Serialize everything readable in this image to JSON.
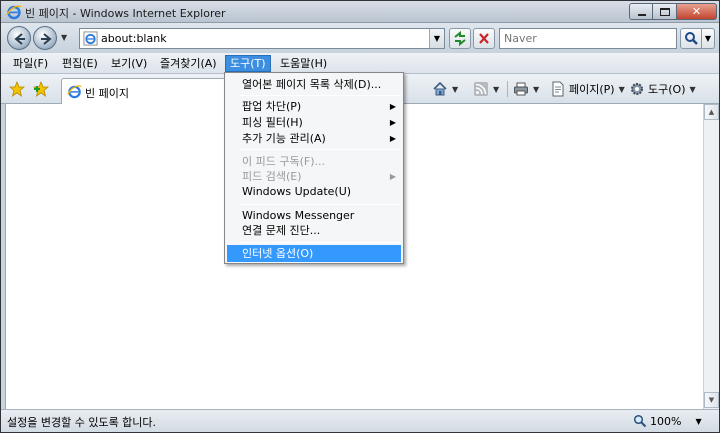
{
  "window": {
    "title": "빈 페이지 - Windows Internet Explorer"
  },
  "address_bar": {
    "url": "about:blank",
    "search_placeholder": "Naver"
  },
  "menu_bar": {
    "items": [
      {
        "label": "파일(F)"
      },
      {
        "label": "편집(E)"
      },
      {
        "label": "보기(V)"
      },
      {
        "label": "즐겨찾기(A)"
      },
      {
        "label": "도구(T)",
        "active": true
      },
      {
        "label": "도움말(H)"
      }
    ]
  },
  "tab": {
    "label": "빈 페이지"
  },
  "command_bar": {
    "page_label": "페이지(P)",
    "tools_label": "도구(O)"
  },
  "tools_menu": {
    "items": [
      {
        "label": "열어본 페이지 목록 삭제(D)..."
      },
      {
        "label": "팝업 차단(P)",
        "submenu": true
      },
      {
        "label": "피싱 필터(H)",
        "submenu": true
      },
      {
        "label": "추가 기능 관리(A)",
        "submenu": true
      },
      {
        "label": "이 피드 구독(F)...",
        "disabled": true
      },
      {
        "label": "피드 검색(E)",
        "disabled": true,
        "submenu": true
      },
      {
        "label": "Windows Update(U)"
      },
      {
        "label": "Windows Messenger"
      },
      {
        "label": "연결 문제 진단..."
      },
      {
        "label": "인터넷 옵션(O)",
        "selected": true
      }
    ]
  },
  "status_bar": {
    "text": "설정을 변경할 수 있도록 합니다.",
    "zoom": "100%"
  },
  "colors": {
    "menu_highlight": "#3399ff",
    "active_menu": "#3b8ee0"
  }
}
